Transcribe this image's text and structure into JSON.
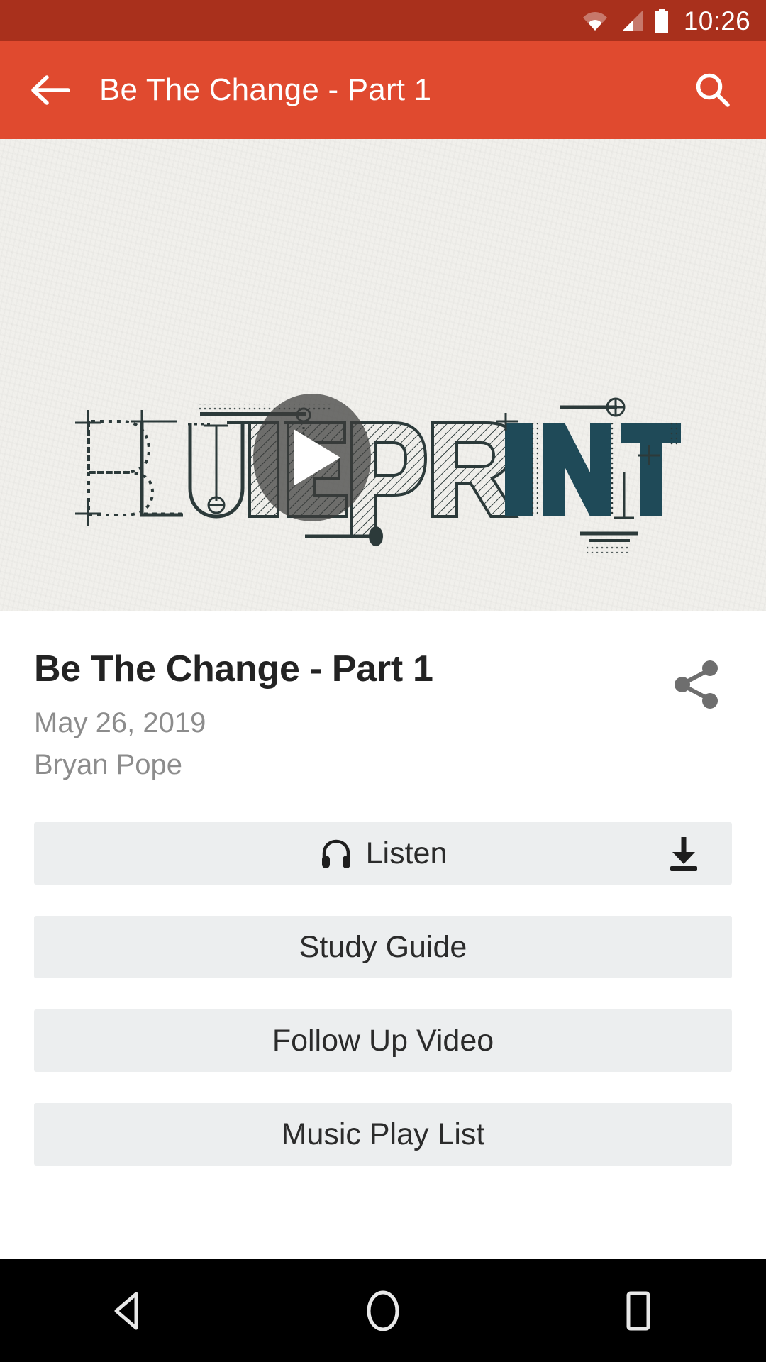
{
  "status_bar": {
    "time": "10:26",
    "icons": [
      "wifi-icon",
      "cellular-signal-icon",
      "battery-icon"
    ],
    "background_color": "#A9301C"
  },
  "toolbar": {
    "title": "Be The Change - Part 1",
    "back_icon": "back-arrow-icon",
    "search_icon": "search-icon",
    "background_color": "#E04A2F"
  },
  "hero": {
    "artwork_text": "BLUEPRINT",
    "artwork_style": "blueprint-technical-drawing",
    "play_icon": "play-icon",
    "background_color": "#F1F0EC",
    "ink_color": "#1F4A58"
  },
  "details": {
    "title": "Be The Change - Part 1",
    "date": "May 26, 2019",
    "author": "Bryan Pope",
    "share_icon": "share-icon"
  },
  "actions": [
    {
      "label": "Listen",
      "leading_icon": "headphones-icon",
      "trailing_icon": "download-icon"
    },
    {
      "label": "Study Guide",
      "leading_icon": null,
      "trailing_icon": null
    },
    {
      "label": "Follow Up Video",
      "leading_icon": null,
      "trailing_icon": null
    },
    {
      "label": "Music Play List",
      "leading_icon": null,
      "trailing_icon": null
    }
  ],
  "nav_bar": {
    "back": "nav-back-icon",
    "home": "nav-home-icon",
    "recents": "nav-recents-icon",
    "background_color": "#000000"
  }
}
